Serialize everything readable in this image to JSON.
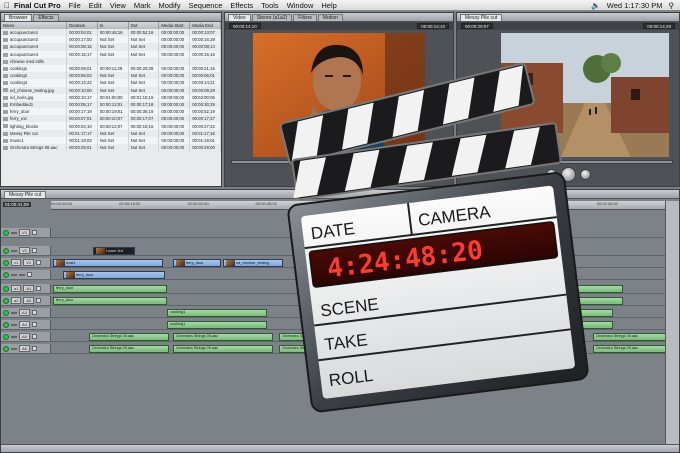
{
  "menubar": {
    "app_name": "Final Cut Pro",
    "items": [
      "File",
      "Edit",
      "View",
      "Mark",
      "Modify",
      "Sequence",
      "Effects",
      "Tools",
      "Window",
      "Help"
    ],
    "clock": "Wed 1:17:30 PM"
  },
  "browser": {
    "tabs": [
      "Browser",
      "Effects"
    ],
    "columns": [
      "Name",
      "Duration",
      "In",
      "Out",
      "Media Start",
      "Media End"
    ],
    "rows": [
      [
        "accupuncture1",
        "00:00:04;01",
        "00:00:48;16",
        "00:00:52;16",
        "00:00:00;00",
        "00:00:13;07"
      ],
      [
        "accupuncture2",
        "00:00:17;00",
        "Not Set",
        "Not Set",
        "00:00:00;00",
        "00:00:16;29"
      ],
      [
        "accupuncture3",
        "00:00:08;15",
        "Not Set",
        "Not Set",
        "00:00:00;00",
        "00:00:08;14"
      ],
      [
        "accupuncture4",
        "00:00:15;17",
        "Not Set",
        "Not Set",
        "00:00:00;00",
        "00:00:15;16"
      ],
      [
        "chinese med stills",
        "",
        "",
        "",
        "",
        ""
      ],
      [
        "cooking1",
        "00:00:09;01",
        "00:00:11;28",
        "00:00:20;28",
        "00:00:00;00",
        "00:00:21;15"
      ],
      [
        "cooking2",
        "00:00:06;02",
        "Not Set",
        "Not Set",
        "00:00:00;00",
        "00:00:06;01"
      ],
      [
        "cooking3",
        "00:00:14;22",
        "Not Set",
        "Not Set",
        "00:00:00;00",
        "00:00:14;21"
      ],
      [
        "ed_chinese_testing.jpg",
        "00:00:10;00",
        "Not Set",
        "Not Set",
        "00:00:00;00",
        "00:00:09;29"
      ],
      [
        "ed_boris.jpg",
        "00:00:10;17",
        "00:01:00;00",
        "00:01:10;16",
        "00:00:00;00",
        "00:02:00;05"
      ],
      [
        "Embedded1",
        "00:00:05;17",
        "00:00:12;01",
        "00:00:17;18",
        "00:00:00;00",
        "00:00:30;25"
      ],
      [
        "ferry_door",
        "00:00:17;19",
        "00:00:19;01",
        "00:00:36;19",
        "00:00:00;00",
        "00:00:52;19"
      ],
      [
        "ferry_ext",
        "00:00:07;01",
        "00:00:10;07",
        "00:00:17;07",
        "00:00:00;00",
        "00:00:17;27"
      ],
      [
        "lighting_blocks",
        "00:00:04;10",
        "00:00:12;07",
        "00:00:16;16",
        "00:00:00;00",
        "00:00:27;22"
      ],
      [
        "Messy Pile cut",
        "00:01:17;17",
        "Not Set",
        "Not Set",
        "00:00:00;00",
        "00:01:17;16"
      ],
      [
        "music1",
        "00:01:19;02",
        "Not Set",
        "Not Set",
        "00:00:00;00",
        "00:01:19;01"
      ],
      [
        "Orchestra Strings 09.aac",
        "00:00:29;01",
        "Not Set",
        "Not Set",
        "00:00:00;00",
        "00:00:29;00"
      ]
    ]
  },
  "viewer": {
    "tabs": [
      "Video",
      "Stereo (a1a2)",
      "Filters",
      "Motion"
    ],
    "duration": "00:00:14;10",
    "timecode": "00:00:14;10"
  },
  "canvas": {
    "tabs": [
      "Messy Pile cut"
    ],
    "duration": "00:00:20;07",
    "timecode": "00:00:14;29"
  },
  "timeline": {
    "tab": "Messy Pile cut",
    "current_timecode": "01:00:41;09",
    "ruler_ticks": [
      "00:00:00;00",
      "00:00:16;00",
      "00:00:32;00",
      "00:00:48;00",
      "00:01:04;00",
      "00:01:20;00",
      "00:01:36;00",
      "00:01:52;00",
      "00:02:08;00"
    ],
    "tracks": [
      {
        "patch": "",
        "name": "V3",
        "clips": []
      },
      {
        "patch": "",
        "name": "V2",
        "clips": [
          {
            "label": "Lower 3rd",
            "kind": "dark"
          }
        ]
      },
      {
        "patch": "v1",
        "name": "V1",
        "clips": [
          {
            "label": "boat1",
            "kind": "video"
          },
          {
            "label": "ferry_door",
            "kind": "video"
          },
          {
            "label": "ed_chinese_testing",
            "kind": "video"
          }
        ]
      },
      {
        "patch": "",
        "name": "",
        "clips": [
          {
            "label": "ferry_door",
            "kind": "video"
          }
        ]
      },
      {
        "patch": "a1",
        "name": "A1",
        "clips": [
          {
            "label": "ferry_door",
            "kind": "audio"
          },
          {
            "label": "ferry_door",
            "kind": "audio"
          }
        ]
      },
      {
        "patch": "a2",
        "name": "A2",
        "clips": [
          {
            "label": "ferry_door",
            "kind": "audio"
          },
          {
            "label": "ferry_door",
            "kind": "audio"
          }
        ]
      },
      {
        "patch": "",
        "name": "A3",
        "clips": [
          {
            "label": "cooking1",
            "kind": "audio"
          },
          {
            "label": "cooking1",
            "kind": "audio"
          }
        ]
      },
      {
        "patch": "",
        "name": "A4",
        "clips": [
          {
            "label": "cooking1",
            "kind": "audio"
          },
          {
            "label": "cooking1",
            "kind": "audio"
          }
        ]
      },
      {
        "patch": "",
        "name": "A5",
        "clips": [
          {
            "label": "Orchestra Strings 09.aac",
            "kind": "audio"
          },
          {
            "label": "Orchestra Strings 09.aac",
            "kind": "audio"
          },
          {
            "label": "Orchestra Strings 09.aac",
            "kind": "audio"
          },
          {
            "label": "Orchestra Strings 09.aac",
            "kind": "audio"
          }
        ]
      },
      {
        "patch": "",
        "name": "A6",
        "clips": [
          {
            "label": "Orchestra Strings 09.aac",
            "kind": "audio"
          },
          {
            "label": "Orchestra Strings 09.aac",
            "kind": "audio"
          },
          {
            "label": "Orchestra Strings 09.aac",
            "kind": "audio"
          },
          {
            "label": "Orchestra Strings 09.aac",
            "kind": "audio"
          }
        ]
      }
    ]
  },
  "clapperboard": {
    "date_label": "DATE",
    "camera_label": "CAMERA",
    "timecode": "4:24:48:20",
    "scene_label": "SCENE",
    "take_label": "TAKE",
    "roll_label": "ROLL"
  },
  "colors": {
    "video_clip": "#8fb4e4",
    "audio_clip": "#8fcb90",
    "timecode_led": "#ff3b2e",
    "track_enable": "#2ec14b"
  }
}
